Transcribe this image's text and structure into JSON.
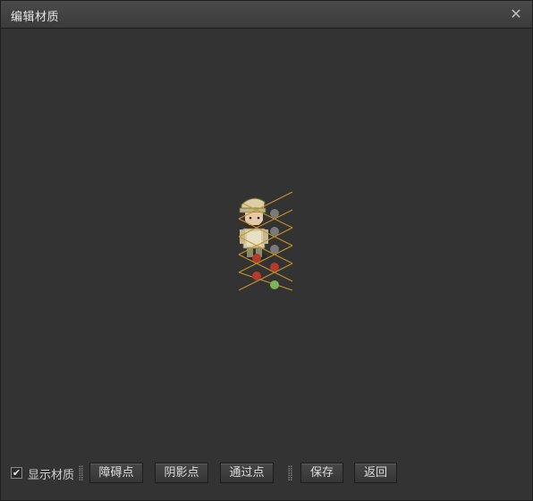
{
  "window": {
    "title": "编辑材质",
    "close_glyph": "✕"
  },
  "toolbar": {
    "show_material": {
      "label": "显示材质",
      "checked": true,
      "check_glyph": "✔"
    },
    "buttons": [
      {
        "id": "obstacle",
        "label": "障碍点"
      },
      {
        "id": "shadow",
        "label": "阴影点"
      },
      {
        "id": "pass",
        "label": "通过点"
      },
      {
        "id": "save",
        "label": "保存"
      },
      {
        "id": "back",
        "label": "返回"
      }
    ]
  },
  "scene": {
    "grid_color": "#c8962a",
    "point_colors": {
      "obstacle": "#b23a2e",
      "shadow": "#7a7a7a",
      "pass": "#7fb35a"
    },
    "points": [
      {
        "type": "shadow"
      },
      {
        "type": "shadow"
      },
      {
        "type": "shadow"
      },
      {
        "type": "obstacle"
      },
      {
        "type": "obstacle"
      },
      {
        "type": "obstacle"
      },
      {
        "type": "pass"
      }
    ]
  }
}
